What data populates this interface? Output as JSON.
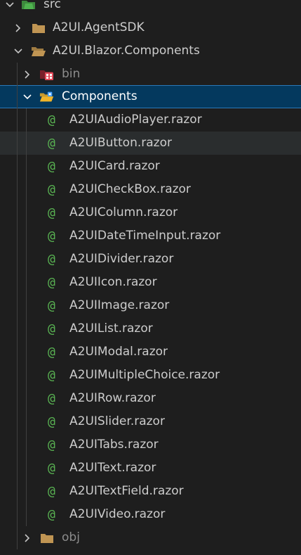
{
  "explorer": {
    "root": {
      "label": "src",
      "icon": "src-folder-icon"
    },
    "folders": [
      {
        "label": "A2UI.AgentSDK",
        "icon": "folder-icon",
        "expanded": false
      },
      {
        "label": "A2UI.Blazor.Components",
        "icon": "folder-open-icon",
        "expanded": true
      }
    ],
    "bin": {
      "label": "bin",
      "icon": "bin-folder-icon",
      "expanded": false
    },
    "components": {
      "label": "Components",
      "icon": "components-folder-open-icon",
      "expanded": true,
      "selected": true
    },
    "file_prefix_glyph": "@",
    "files": [
      "A2UIAudioPlayer.razor",
      "A2UIButton.razor",
      "A2UICard.razor",
      "A2UICheckBox.razor",
      "A2UIColumn.razor",
      "A2UIDateTimeInput.razor",
      "A2UIDivider.razor",
      "A2UIIcon.razor",
      "A2UIImage.razor",
      "A2UIList.razor",
      "A2UIModal.razor",
      "A2UIMultipleChoice.razor",
      "A2UIRow.razor",
      "A2UISlider.razor",
      "A2UITabs.razor",
      "A2UIText.razor",
      "A2UITextField.razor",
      "A2UIVideo.razor"
    ],
    "hovered_file": "A2UIButton.razor",
    "obj": {
      "label": "obj",
      "icon": "folder-icon",
      "expanded": false
    }
  },
  "colors": {
    "background": "#1e1e1e",
    "selection": "#04395e",
    "selection_border": "#2b79b8",
    "hover": "#2a2d2e",
    "razor_glyph": "#59b352",
    "folder": "#c09553"
  }
}
